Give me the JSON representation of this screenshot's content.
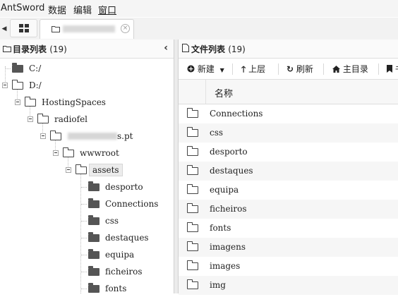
{
  "app": {
    "title": "AntSword"
  },
  "menu": [
    "数据",
    "编辑",
    "窗口"
  ],
  "tabs": {
    "close_glyph": "×"
  },
  "dir_panel": {
    "title": "目录列表",
    "count": "(19)"
  },
  "tree": [
    {
      "label": "C:/"
    },
    {
      "label": "D:/"
    },
    {
      "label": "HostingSpaces"
    },
    {
      "label": "radiofel"
    },
    {
      "label": "s.pt"
    },
    {
      "label": "wwwroot"
    },
    {
      "label": "assets"
    },
    {
      "label": "desporto"
    },
    {
      "label": "Connections"
    },
    {
      "label": "css"
    },
    {
      "label": "destaques"
    },
    {
      "label": "equipa"
    },
    {
      "label": "ficheiros"
    },
    {
      "label": "fonts"
    }
  ],
  "file_panel": {
    "title": "文件列表",
    "count": "(19)"
  },
  "toolbar": {
    "new": "新建",
    "up": "上层",
    "refresh": "刷新",
    "home": "主目录",
    "more": "书"
  },
  "grid": {
    "col_name": "名称"
  },
  "files": [
    "Connections",
    "css",
    "desporto",
    "destaques",
    "equipa",
    "ficheiros",
    "fonts",
    "imagens",
    "images",
    "img"
  ],
  "icons": {
    "grid": "grid-icon",
    "folder": "folder-icon",
    "file": "file-icon",
    "plus": "plus-circle-icon",
    "up": "arrow-up-icon",
    "refresh": "refresh-icon",
    "home": "home-icon",
    "bookmark": "bookmark-icon"
  }
}
